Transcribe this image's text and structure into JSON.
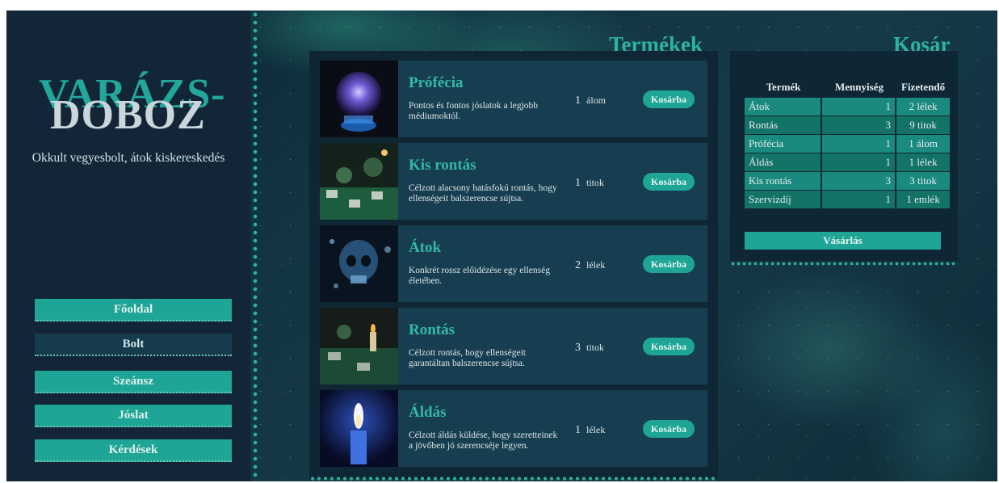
{
  "brand": {
    "logo_top": "VARÁZS-",
    "logo_bottom": "DOBOZ",
    "tagline": "Okkult vegyesbolt, átok kiskereskedés"
  },
  "nav": {
    "items": [
      {
        "label": "Főoldal",
        "active": false
      },
      {
        "label": "Bolt",
        "active": true
      },
      {
        "label": "Szeánsz",
        "active": false
      },
      {
        "label": "Jóslat",
        "active": false
      },
      {
        "label": "Kérdések",
        "active": false
      }
    ]
  },
  "products": {
    "title": "Termékek",
    "button_label": "Kosárba",
    "items": [
      {
        "name": "Prófécia",
        "desc": "Pontos és fontos jóslatok a legjobb médiumoktól.",
        "qty": "1",
        "unit": "álom"
      },
      {
        "name": "Kis rontás",
        "desc": "Célzott alacsony hatásfokú rontás, hogy ellenségeit balszerencse sújtsa.",
        "qty": "1",
        "unit": "titok"
      },
      {
        "name": "Átok",
        "desc": "Konkrét rossz előidézése egy ellenség életében.",
        "qty": "2",
        "unit": "lélek"
      },
      {
        "name": "Rontás",
        "desc": "Célzott rontás, hogy ellenségeit garantáltan balszerencse sújtsa.",
        "qty": "3",
        "unit": "titok"
      },
      {
        "name": "Áldás",
        "desc": "Célzott áldás küldése, hogy szeretteinek a jövőben jó szerencséje legyen.",
        "qty": "1",
        "unit": "lélek"
      }
    ]
  },
  "cart": {
    "title": "Kosár",
    "headers": {
      "product": "Termék",
      "qty": "Mennyiség",
      "total": "Fizetendő"
    },
    "rows": [
      {
        "name": "Átok",
        "qty": "1",
        "total": "2 lélek"
      },
      {
        "name": "Rontás",
        "qty": "3",
        "total": "9 titok"
      },
      {
        "name": "Prófécia",
        "qty": "1",
        "total": "1 álom"
      },
      {
        "name": "Áldás",
        "qty": "1",
        "total": "1 lélek"
      },
      {
        "name": "Kis rontás",
        "qty": "3",
        "total": "3 titok"
      },
      {
        "name": "Szervizdíj",
        "qty": "1",
        "total": "1 emlék"
      }
    ],
    "buy_label": "Vásárlás"
  },
  "colors": {
    "accent": "#1fa596",
    "sidebar_bg": "#122637",
    "panel_bg": "#0f2735",
    "card_bg": "#173e50"
  }
}
